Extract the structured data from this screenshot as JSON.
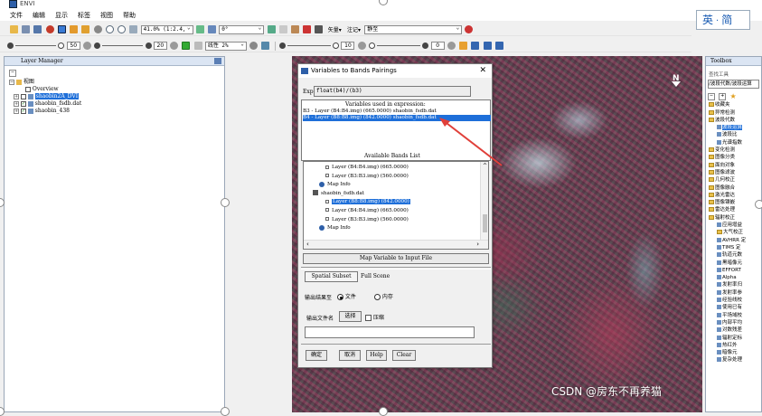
{
  "app": {
    "title": "ENVI"
  },
  "menu": [
    "文件",
    "编辑",
    "显示",
    "标签",
    "视图",
    "帮助"
  ],
  "toolbar1": {
    "zoom": "41.0% (1:2.4,",
    "rotation": "0°",
    "vector_label": "矢量▾",
    "annotate_label": "注记▾",
    "layer_combo": "静至"
  },
  "toolbar2": {
    "brightness": "50",
    "contrast": "20",
    "stretch": "线性 2%",
    "sharpen": "10",
    "transparency": "0"
  },
  "ime": {
    "lang": "英",
    "mode": "简"
  },
  "layer_manager": {
    "title": "Layer Manager",
    "root": "视图",
    "items": [
      {
        "label": "Overview",
        "checked": false
      },
      {
        "label": "shaobin2A_DVI",
        "checked": false,
        "selected": true
      },
      {
        "label": "shaobin_fsdb.dat",
        "checked": true
      },
      {
        "label": "shaobin_438",
        "checked": true
      }
    ]
  },
  "dialog": {
    "title": "Variables to Bands Pairings",
    "expression_label": "Exp:",
    "expression": "float(b4)/(b3)",
    "vars_heading": "Variables used in expression:",
    "vars": [
      {
        "text": "B3 - Layer (B4:B4.img) (665.0000) shaobin_fsdb.dat",
        "selected": false
      },
      {
        "text": "B4 - Layer (B8:B8.img) (842.0000) shaobin_fsdb.dat",
        "selected": true
      }
    ],
    "bands_heading": "Available Bands List",
    "bands": [
      {
        "text": "Layer (B4:B4.img) (665.0000)",
        "indent": 2,
        "kind": "band"
      },
      {
        "text": "Layer (B3:B3.img) (560.0000)",
        "indent": 2,
        "kind": "band"
      },
      {
        "text": "Map Info",
        "indent": 1,
        "kind": "map"
      },
      {
        "text": "shaobin_fsdb.dat",
        "indent": 0,
        "kind": "file"
      },
      {
        "text": "Layer (B8:B8.img) (842.0000)",
        "indent": 2,
        "kind": "band",
        "selected": true
      },
      {
        "text": "Layer (B4:B4.img) (665.0000)",
        "indent": 2,
        "kind": "band"
      },
      {
        "text": "Layer (B3:B3.img) (560.0000)",
        "indent": 2,
        "kind": "band"
      },
      {
        "text": "Map Info",
        "indent": 1,
        "kind": "map"
      }
    ],
    "map_button": "Map Variable to Input File",
    "spatial_subset_button": "Spatial Subset",
    "spatial_subset_value": "Full Scene",
    "output_to_label": "输出结果至",
    "output_file_option": "文件",
    "output_memory_option": "内存",
    "output_filename_label": "输出文件名",
    "choose_button": "选择",
    "compress_label": "压缩",
    "buttons": [
      "确定",
      "取消",
      "Help",
      "Clear"
    ]
  },
  "toolbox": {
    "title": "Toolbox",
    "search_label": "查找工具",
    "path": "/波段代数/波段运算",
    "items": [
      {
        "label": "收藏夹",
        "type": "folder",
        "indent": 0
      },
      {
        "label": "异常检测",
        "type": "folder",
        "indent": 0
      },
      {
        "label": "波段代数",
        "type": "folder",
        "indent": 0
      },
      {
        "label": "波段运算",
        "type": "tool",
        "indent": 1,
        "selected": true
      },
      {
        "label": "波段比",
        "type": "tool",
        "indent": 1
      },
      {
        "label": "光谱指数",
        "type": "tool",
        "indent": 1
      },
      {
        "label": "变化检测",
        "type": "folder",
        "indent": 0
      },
      {
        "label": "图像分类",
        "type": "folder",
        "indent": 0
      },
      {
        "label": "面向对象",
        "type": "folder",
        "indent": 0
      },
      {
        "label": "图像滤波",
        "type": "folder",
        "indent": 0
      },
      {
        "label": "几何校正",
        "type": "folder",
        "indent": 0
      },
      {
        "label": "图像融合",
        "type": "folder",
        "indent": 0
      },
      {
        "label": "激光雷达",
        "type": "folder",
        "indent": 0
      },
      {
        "label": "图像镶嵌",
        "type": "folder",
        "indent": 0
      },
      {
        "label": "雷达处理",
        "type": "folder",
        "indent": 0
      },
      {
        "label": "辐射校正",
        "type": "folder",
        "indent": 0
      },
      {
        "label": "应用增益",
        "type": "tool",
        "indent": 1
      },
      {
        "label": "大气校正",
        "type": "folder",
        "indent": 1
      },
      {
        "label": "AVHRR 定",
        "type": "tool",
        "indent": 1
      },
      {
        "label": "TIMS 定",
        "type": "tool",
        "indent": 1
      },
      {
        "label": "轨道元数",
        "type": "tool",
        "indent": 1
      },
      {
        "label": "黑暗像元",
        "type": "tool",
        "indent": 1
      },
      {
        "label": "EFFORT",
        "type": "tool",
        "indent": 1
      },
      {
        "label": "Alpha",
        "type": "tool",
        "indent": 1
      },
      {
        "label": "发射率归",
        "type": "tool",
        "indent": 1
      },
      {
        "label": "发射率参",
        "type": "tool",
        "indent": 1
      },
      {
        "label": "经验线校",
        "type": "tool",
        "indent": 1
      },
      {
        "label": "使用已有",
        "type": "tool",
        "indent": 1
      },
      {
        "label": "平场域校",
        "type": "tool",
        "indent": 1
      },
      {
        "label": "内部平均",
        "type": "tool",
        "indent": 1
      },
      {
        "label": "对数残差",
        "type": "tool",
        "indent": 1
      },
      {
        "label": "辐射定标",
        "type": "tool",
        "indent": 1
      },
      {
        "label": "热红外",
        "type": "tool",
        "indent": 1
      },
      {
        "label": "暗像元",
        "type": "tool",
        "indent": 1
      },
      {
        "label": "复杂处理",
        "type": "tool",
        "indent": 1
      }
    ]
  },
  "watermark": "CSDN @房东不再养猫",
  "colors": {
    "selection": "#1e6fd9",
    "arrow": "#e0403a"
  }
}
